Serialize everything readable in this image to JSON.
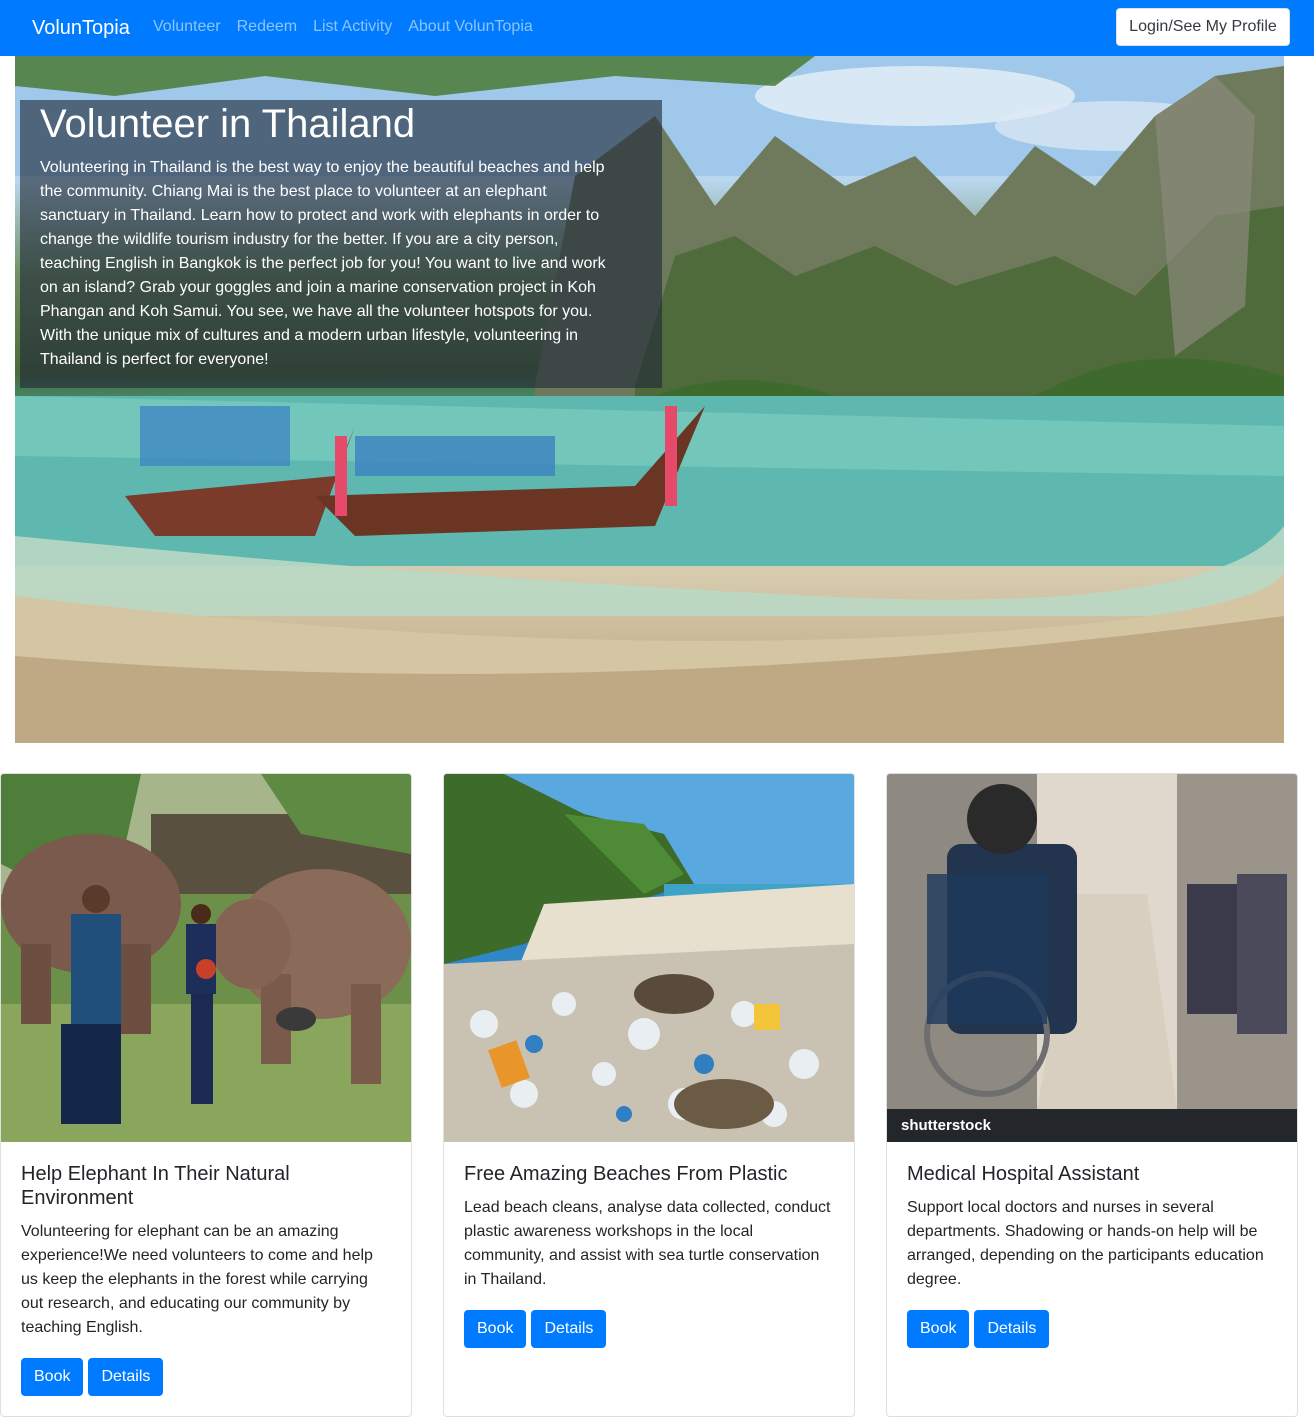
{
  "navbar": {
    "brand": "VolunTopia",
    "links": [
      "Volunteer",
      "Redeem",
      "List Activity",
      "About VolunTopia"
    ],
    "login_label": "Login/See My Profile"
  },
  "hero": {
    "title": "Volunteer in Thailand",
    "text": "Volunteering in Thailand is the best way to enjoy the beautiful beaches and help the community. Chiang Mai is the best place to volunteer at an elephant sanctuary in Thailand. Learn how to protect and work with elephants in order to change the wildlife tourism industry for the better. If you are a city person, teaching English in Bangkok is the perfect job for you! You want to live and work on an island? Grab your goggles and join a marine conservation project in Koh Phangan and Koh Samui. You see, we have all the volunteer hotspots for you. With the unique mix of cultures and a modern urban lifestyle, volunteering in Thailand is perfect for everyone!"
  },
  "cards": [
    {
      "title": "Help Elephant In Their Natural Environment",
      "text": "Volunteering for elephant can be an amazing experience!We need volunteers to come and help us keep the elephants in the forest while carrying out research, and educating our community by teaching English.",
      "book_label": "Book",
      "details_label": "Details"
    },
    {
      "title": "Free Amazing Beaches From Plastic",
      "text": "Lead beach cleans, analyse data collected, conduct plastic awareness workshops in the local community, and assist with sea turtle conservation in Thailand.",
      "book_label": "Book",
      "details_label": "Details"
    },
    {
      "title": "Medical Hospital Assistant",
      "text": "Support local doctors and nurses in several departments. Shadowing or hands-on help will be arranged, depending on the participants education degree.",
      "book_label": "Book",
      "details_label": "Details",
      "image_watermark": "shutterstock"
    }
  ],
  "colors": {
    "primary": "#007bff",
    "nav_link": "rgba(255,255,255,0.55)",
    "text": "#212529"
  }
}
